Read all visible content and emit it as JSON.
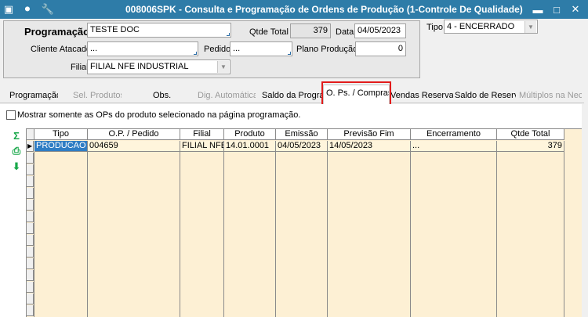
{
  "window": {
    "title": "008006SPK - Consulta e Programação de Ordens de Produção (1-Controle De Qualidade)",
    "minimize": "▬",
    "restore": "□",
    "close": "✕"
  },
  "form": {
    "programacao_label": "Programação",
    "programacao_value": "TESTE DOC",
    "qtde_total_label": "Qtde Total",
    "qtde_total_value": "379",
    "data_label": "Data",
    "data_value": "04/05/2023",
    "tipo_label": "Tipo",
    "tipo_value": "4 - ENCERRADO",
    "cliente_label": "Cliente Atacado",
    "cliente_value": "...",
    "pedido_label": "Pedido",
    "pedido_value": "...",
    "plano_label": "Plano Produção",
    "plano_value": "0",
    "filial_label": "Filial",
    "filial_value": "FILIAL NFE INDUSTRIAL"
  },
  "tabs": [
    {
      "label": "Programação"
    },
    {
      "label": "Sel. Produtos"
    },
    {
      "label": "Obs."
    },
    {
      "label": "Dig. Automática"
    },
    {
      "label": "Saldo da Programação"
    },
    {
      "label": "O. Ps. / Compras"
    },
    {
      "label": "Vendas Reservadas"
    },
    {
      "label": "Saldo de Reserva"
    },
    {
      "label": "Múltiplos na Necessidade"
    }
  ],
  "content": {
    "checkbox_label": "Mostrar somente as OPs do produto selecionado na página programação."
  },
  "grid": {
    "columns": [
      "Tipo",
      "O.P. / Pedido",
      "Filial",
      "Produto",
      "Emissão",
      "Previsão Fim",
      "Encerramento",
      "Qtde Total"
    ],
    "rows": [
      [
        "PRODUCAO",
        "004659",
        "FILIAL NFE",
        "14.01.0001",
        "04/05/2023",
        "14/05/2023",
        "...",
        "379"
      ]
    ]
  },
  "colors": {
    "titlebar": "#2e7ca8",
    "highlight": "#e21b1b",
    "grid_bg": "#fdf0d4",
    "selected_cell": "#2f7dc4",
    "side_icons": "#19a84a"
  }
}
